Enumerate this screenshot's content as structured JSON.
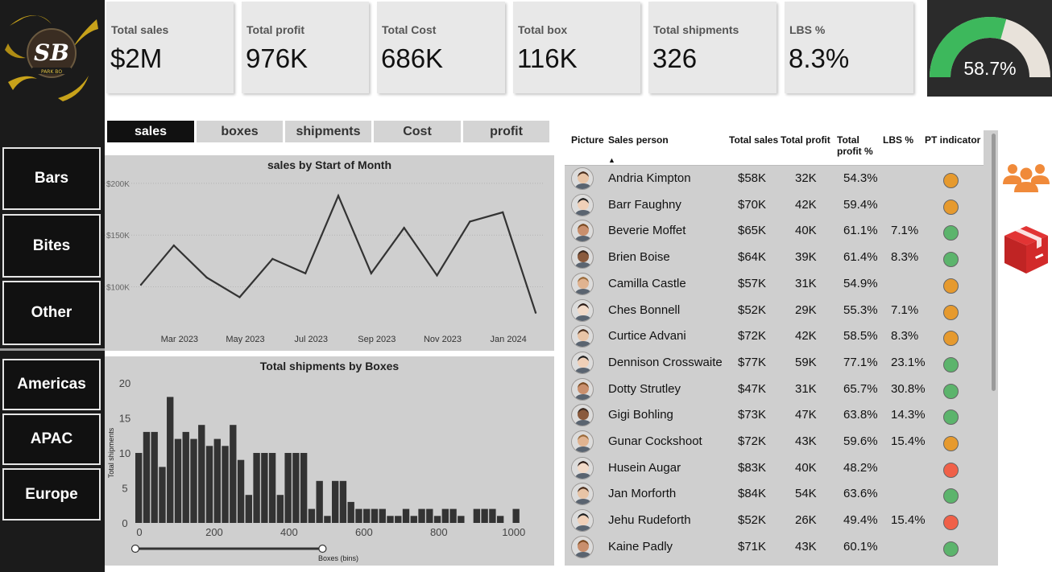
{
  "nav": {
    "logo": {
      "letters": "SB",
      "tagline": "PARK BO"
    },
    "category_buttons": [
      "Bars",
      "Bites",
      "Other"
    ],
    "region_buttons": [
      "Americas",
      "APAC",
      "Europe"
    ]
  },
  "kpis": [
    {
      "label": "Total sales",
      "value": "$2M"
    },
    {
      "label": "Total profit",
      "value": "976K"
    },
    {
      "label": "Total Cost",
      "value": "686K"
    },
    {
      "label": "Total box",
      "value": "116K"
    },
    {
      "label": "Total shipments",
      "value": "326"
    },
    {
      "label": "LBS %",
      "value": "8.3%"
    }
  ],
  "gauge": {
    "value_label": "58.7%",
    "fraction": 0.587,
    "fill_color": "#3db85c",
    "track_color": "#e8e2da"
  },
  "tabs": [
    "sales",
    "boxes",
    "shipments",
    "Cost",
    "profit"
  ],
  "active_tab": "sales",
  "line_chart": {
    "chart_data": {
      "type": "line",
      "title": "sales by Start of Month",
      "x": [
        "Feb 2023",
        "Mar 2023",
        "Apr 2023",
        "May 2023",
        "Jun 2023",
        "Jul 2023",
        "Aug 2023",
        "Sep 2023",
        "Oct 2023",
        "Nov 2023",
        "Dec 2023",
        "Jan 2024",
        "Feb 2024"
      ],
      "x_tick_labels": [
        "Mar 2023",
        "May 2023",
        "Jul 2023",
        "Sep 2023",
        "Nov 2023",
        "Jan 2024"
      ],
      "values": [
        102000,
        140000,
        109000,
        90000,
        127000,
        113000,
        188000,
        113000,
        157000,
        111000,
        163000,
        172000,
        75000
      ],
      "y_tick_labels": [
        "$100K",
        "$150K",
        "$200K"
      ],
      "y_ticks": [
        100000,
        150000,
        200000
      ],
      "ylim": [
        60000,
        210000
      ],
      "grid": true,
      "line_color": "#333333"
    }
  },
  "histogram": {
    "chart_data": {
      "type": "bar",
      "title": "Total shipments by Boxes",
      "xlabel": "Boxes (bins)",
      "ylabel": "Total shipments",
      "x_tick_labels": [
        "0",
        "200",
        "400",
        "600",
        "800",
        "1000"
      ],
      "x_ticks": [
        0,
        200,
        400,
        600,
        800,
        1000
      ],
      "y_tick_labels": [
        "0",
        "5",
        "10",
        "15",
        "20"
      ],
      "y_ticks": [
        0,
        5,
        10,
        15,
        20
      ],
      "ylim": [
        0,
        20
      ],
      "xlim": [
        0,
        1050
      ],
      "bin_width": 21,
      "bin_starts": [
        0,
        21,
        42,
        63,
        84,
        105,
        126,
        147,
        168,
        189,
        210,
        231,
        252,
        273,
        294,
        315,
        336,
        357,
        378,
        399,
        420,
        441,
        462,
        483,
        504,
        525,
        546,
        567,
        588,
        609,
        630,
        651,
        672,
        693,
        714,
        735,
        756,
        777,
        798,
        819,
        840,
        861,
        882,
        903,
        924,
        945,
        966,
        987,
        1008
      ],
      "values": [
        10,
        13,
        13,
        8,
        18,
        12,
        13,
        12,
        14,
        11,
        12,
        11,
        14,
        9,
        4,
        10,
        10,
        10,
        4,
        10,
        10,
        10,
        2,
        6,
        1,
        6,
        6,
        3,
        2,
        2,
        2,
        2,
        1,
        1,
        2,
        1,
        2,
        2,
        1,
        2,
        2,
        1,
        0,
        2,
        2,
        2,
        1,
        0,
        2
      ],
      "bar_color": "#333333",
      "slider_range": [
        0,
        500
      ]
    }
  },
  "table": {
    "columns": [
      "Picture",
      "Sales person",
      "Total sales",
      "Total profit",
      "Total profit %",
      "LBS %",
      "PT indicator"
    ],
    "rows": [
      {
        "name": "Andria Kimpton",
        "sales": "$58K",
        "profit": "32K",
        "profit_pct": "54.3%",
        "lbs": "",
        "indicator": "orange"
      },
      {
        "name": "Barr Faughny",
        "sales": "$70K",
        "profit": "42K",
        "profit_pct": "59.4%",
        "lbs": "",
        "indicator": "orange"
      },
      {
        "name": "Beverie Moffet",
        "sales": "$65K",
        "profit": "40K",
        "profit_pct": "61.1%",
        "lbs": "7.1%",
        "indicator": "green"
      },
      {
        "name": "Brien Boise",
        "sales": "$64K",
        "profit": "39K",
        "profit_pct": "61.4%",
        "lbs": "8.3%",
        "indicator": "green"
      },
      {
        "name": "Camilla Castle",
        "sales": "$57K",
        "profit": "31K",
        "profit_pct": "54.9%",
        "lbs": "",
        "indicator": "orange"
      },
      {
        "name": "Ches Bonnell",
        "sales": "$52K",
        "profit": "29K",
        "profit_pct": "55.3%",
        "lbs": "7.1%",
        "indicator": "orange"
      },
      {
        "name": "Curtice Advani",
        "sales": "$72K",
        "profit": "42K",
        "profit_pct": "58.5%",
        "lbs": "8.3%",
        "indicator": "orange"
      },
      {
        "name": "Dennison Crosswaite",
        "sales": "$77K",
        "profit": "59K",
        "profit_pct": "77.1%",
        "lbs": "23.1%",
        "indicator": "green"
      },
      {
        "name": "Dotty Strutley",
        "sales": "$47K",
        "profit": "31K",
        "profit_pct": "65.7%",
        "lbs": "30.8%",
        "indicator": "green"
      },
      {
        "name": "Gigi Bohling",
        "sales": "$73K",
        "profit": "47K",
        "profit_pct": "63.8%",
        "lbs": "14.3%",
        "indicator": "green"
      },
      {
        "name": "Gunar Cockshoot",
        "sales": "$72K",
        "profit": "43K",
        "profit_pct": "59.6%",
        "lbs": "15.4%",
        "indicator": "orange"
      },
      {
        "name": "Husein Augar",
        "sales": "$83K",
        "profit": "40K",
        "profit_pct": "48.2%",
        "lbs": "",
        "indicator": "red"
      },
      {
        "name": "Jan Morforth",
        "sales": "$84K",
        "profit": "54K",
        "profit_pct": "63.6%",
        "lbs": "",
        "indicator": "green"
      },
      {
        "name": "Jehu Rudeforth",
        "sales": "$52K",
        "profit": "26K",
        "profit_pct": "49.4%",
        "lbs": "15.4%",
        "indicator": "red"
      },
      {
        "name": "Kaine Padly",
        "sales": "$71K",
        "profit": "43K",
        "profit_pct": "60.1%",
        "lbs": "",
        "indicator": "green"
      }
    ],
    "indicator_colors": {
      "orange": "#e69a2e",
      "green": "#5cb46c",
      "red": "#f06048"
    }
  },
  "side_icons": [
    "people-group-icon",
    "package-box-icon"
  ],
  "colors": {
    "accent_orange": "#f08a3a",
    "box_red": "#d22a2a",
    "sidebar_bg": "#1b1b1b"
  }
}
